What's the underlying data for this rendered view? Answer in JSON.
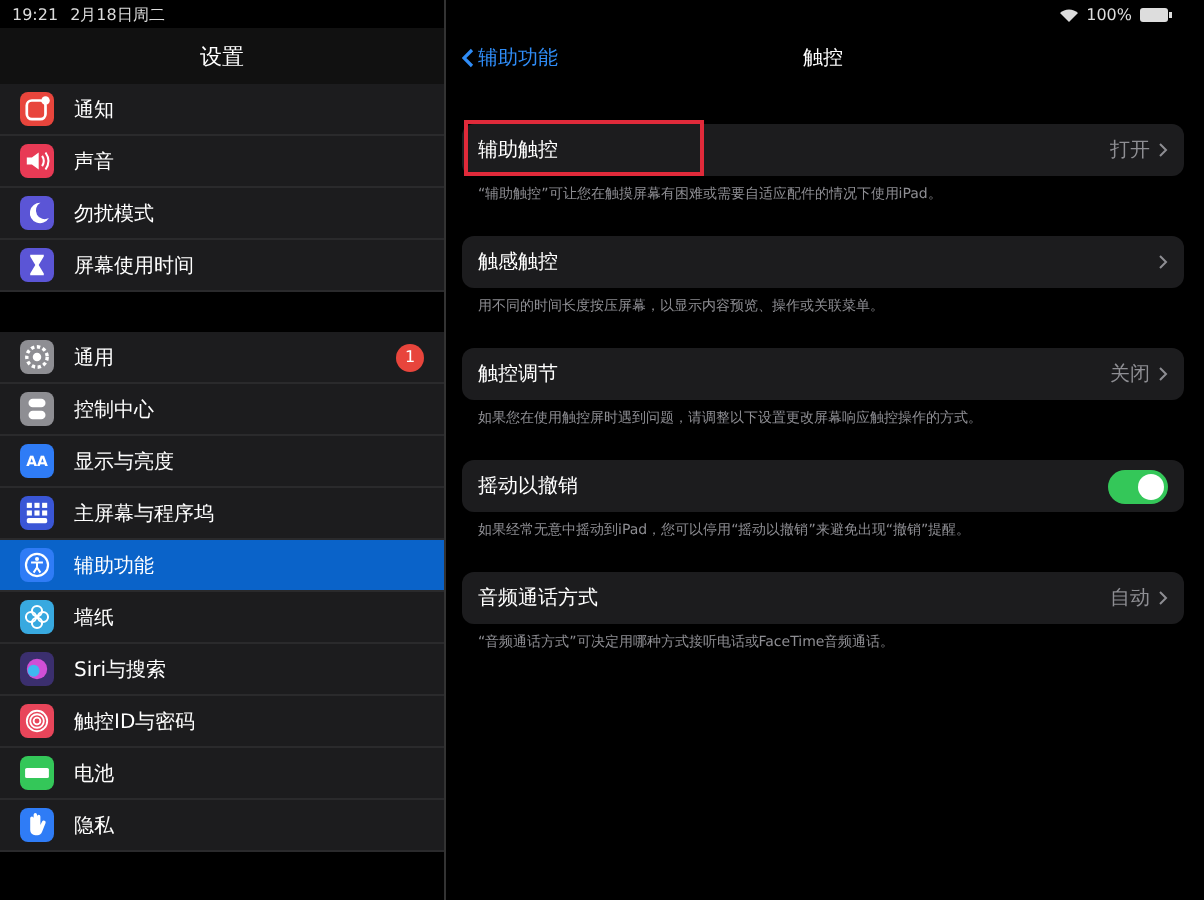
{
  "status_bar": {
    "time": "19:21",
    "date": "2月18日周二",
    "battery": "100%"
  },
  "sidebar": {
    "title": "设置",
    "groups": [
      {
        "items": [
          {
            "label": "通知",
            "kind": "notification",
            "color": "#e8453c",
            "selected": false
          },
          {
            "label": "声音",
            "kind": "sound",
            "color": "#e83a55",
            "selected": false
          },
          {
            "label": "勿扰模式",
            "kind": "moon",
            "color": "#5b55d6",
            "selected": false
          },
          {
            "label": "屏幕使用时间",
            "kind": "hourglass",
            "color": "#5b55d6",
            "selected": false
          }
        ]
      },
      {
        "items": [
          {
            "label": "通用",
            "kind": "gear",
            "color": "#8e8e93",
            "selected": false,
            "badge": "1"
          },
          {
            "label": "控制中心",
            "kind": "switches",
            "color": "#8e8e93",
            "selected": false
          },
          {
            "label": "显示与亮度",
            "kind": "text",
            "glyph": "AA",
            "color": "#2f7cf6",
            "selected": false
          },
          {
            "label": "主屏幕与程序坞",
            "kind": "grid",
            "color": "#3a56d6",
            "selected": false
          },
          {
            "label": "辅助功能",
            "kind": "person",
            "color": "#2f7cf6",
            "selected": true
          },
          {
            "label": "墙纸",
            "kind": "flower",
            "color": "#38a9e0",
            "selected": false
          },
          {
            "label": "Siri与搜索",
            "kind": "orb",
            "color": "#3b2f6e",
            "selected": false
          },
          {
            "label": "触控ID与密码",
            "kind": "fingerprint",
            "color": "#e8455a",
            "selected": false
          },
          {
            "label": "电池",
            "kind": "battery",
            "color": "#34c759",
            "selected": false
          },
          {
            "label": "隐私",
            "kind": "hand",
            "color": "#2f7cf6",
            "selected": false
          }
        ]
      }
    ]
  },
  "nav": {
    "back": "辅助功能",
    "title": "触控"
  },
  "sections": [
    {
      "label": "辅助触控",
      "kind": "link",
      "value": "打开",
      "highlighted": true,
      "footer": "“辅助触控”可让您在触摸屏幕有困难或需要自适应配件的情况下使用iPad。"
    },
    {
      "label": "触感触控",
      "kind": "link",
      "highlighted": false,
      "footer": "用不同的时间长度按压屏幕，以显示内容预览、操作或关联菜单。"
    },
    {
      "label": "触控调节",
      "kind": "link",
      "value": "关闭",
      "highlighted": false,
      "footer": "如果您在使用触控屏时遇到问题，请调整以下设置更改屏幕响应触控操作的方式。"
    },
    {
      "label": "摇动以撤销",
      "kind": "toggle",
      "on": true,
      "highlighted": false,
      "footer": "如果经常无意中摇动到iPad，您可以停用“摇动以撤销”来避免出现“撤销”提醒。"
    },
    {
      "label": "音频通话方式",
      "kind": "link",
      "value": "自动",
      "highlighted": false,
      "footer": "“音频通话方式”可决定用哪种方式接听电话或FaceTime音频通话。"
    }
  ]
}
